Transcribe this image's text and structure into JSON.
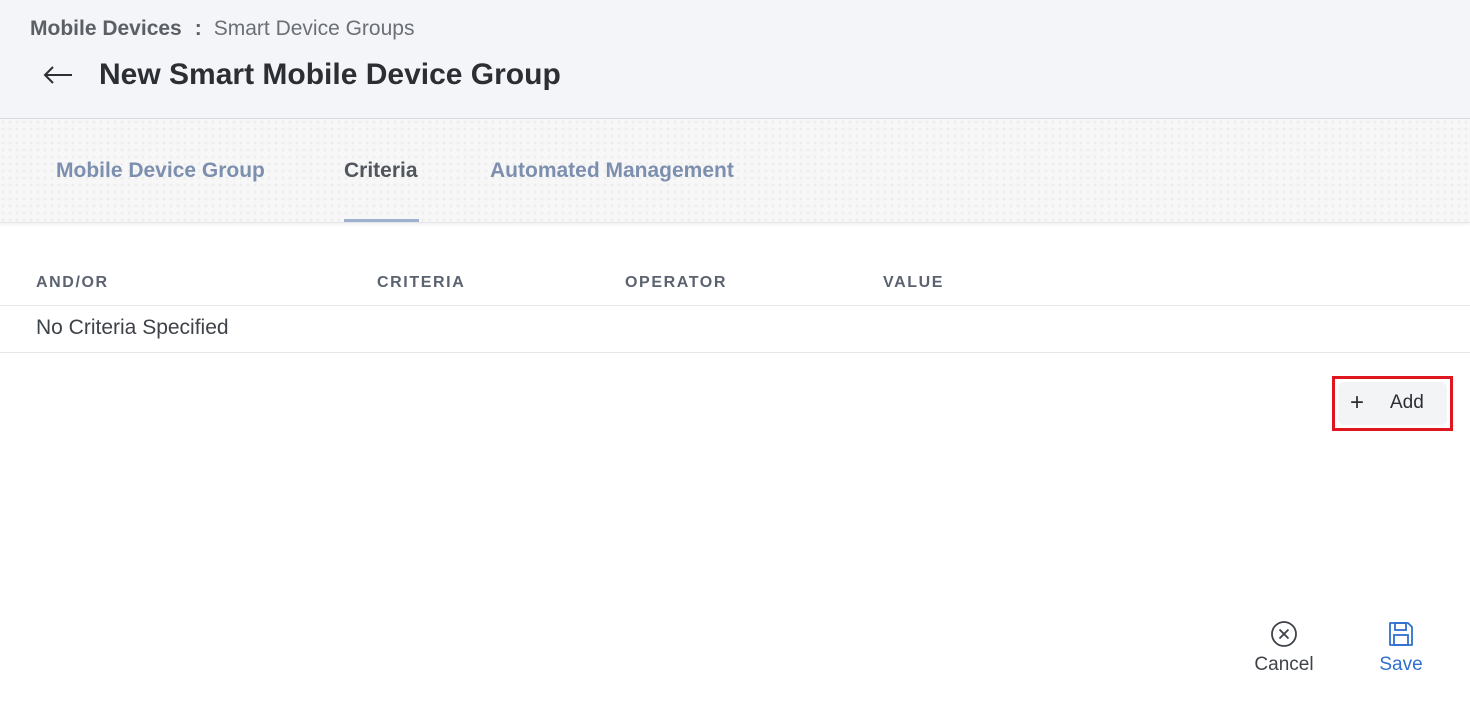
{
  "breadcrumb": {
    "root": "Mobile Devices",
    "separator": ":",
    "current": "Smart Device Groups"
  },
  "header": {
    "back_icon": "arrow-left-icon",
    "title": "New Smart Mobile Device Group"
  },
  "tabs": [
    {
      "label": "Mobile Device Group",
      "active": false
    },
    {
      "label": "Criteria",
      "active": true
    },
    {
      "label": "Automated Management",
      "active": false
    }
  ],
  "table": {
    "columns": [
      "AND/OR",
      "CRITERIA",
      "OPERATOR",
      "VALUE"
    ],
    "empty_message": "No Criteria Specified"
  },
  "add_button": {
    "icon": "plus-icon",
    "label": "Add"
  },
  "actions": {
    "cancel": {
      "label": "Cancel",
      "icon": "close-circle-icon"
    },
    "save": {
      "label": "Save",
      "icon": "save-icon"
    }
  },
  "colors": {
    "header_bg": "#f4f5f8",
    "tab_inactive": "#7d8fae",
    "tab_active": "#51555c",
    "tab_underline": "#9eb2cf",
    "save_blue": "#2f6fd0",
    "highlight_red": "#e0161e"
  }
}
